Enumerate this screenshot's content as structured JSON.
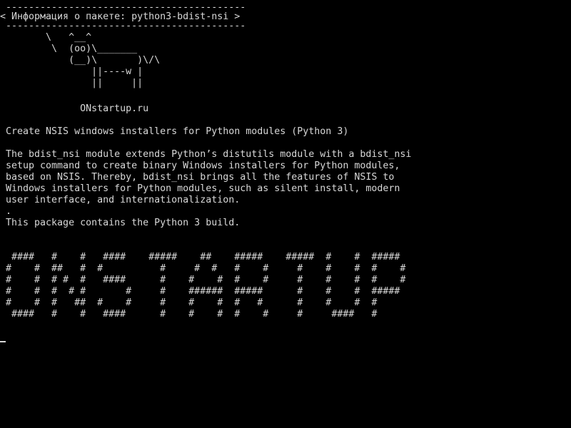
{
  "terminal": {
    "lines": [
      " ------------------------------------------",
      "< Информация о пакете: python3-bdist-nsi >",
      " ------------------------------------------",
      "        \\   ^__^",
      "         \\  (oo)\\_______",
      "            (__)\\       )\\/\\",
      "                ||----w |",
      "                ||     ||",
      "",
      "              ONstartup.ru",
      "",
      " Create NSIS windows installers for Python modules (Python 3)",
      "",
      " The bdist_nsi module extends Python’s distutils module with a bdist_nsi",
      " setup command to create binary Windows installers for Python modules,",
      " based on NSIS. Thereby, bdist_nsi brings all the features of NSIS to",
      " Windows installers for Python modules, such as silent install, modern",
      " user interface, and internationalization.",
      " .",
      " This package contains the Python 3 build.",
      "",
      "",
      "  ####   #    #   ####    #####    ##    #####    #####  #    #  #####",
      " #    #  ##   #  #          #     #  #   #    #     #    #    #  #    #",
      " #    #  # #  #   ####      #    #    #  #    #     #    #    #  #    #",
      " #    #  #  # #       #     #    ######  #####      #    #    #  #####",
      " #    #  #   ##  #    #     #    #    #  #   #      #    #    #  #",
      "  ####   #    #   ####      #    #    #  #    #     #     ####   #"
    ]
  }
}
